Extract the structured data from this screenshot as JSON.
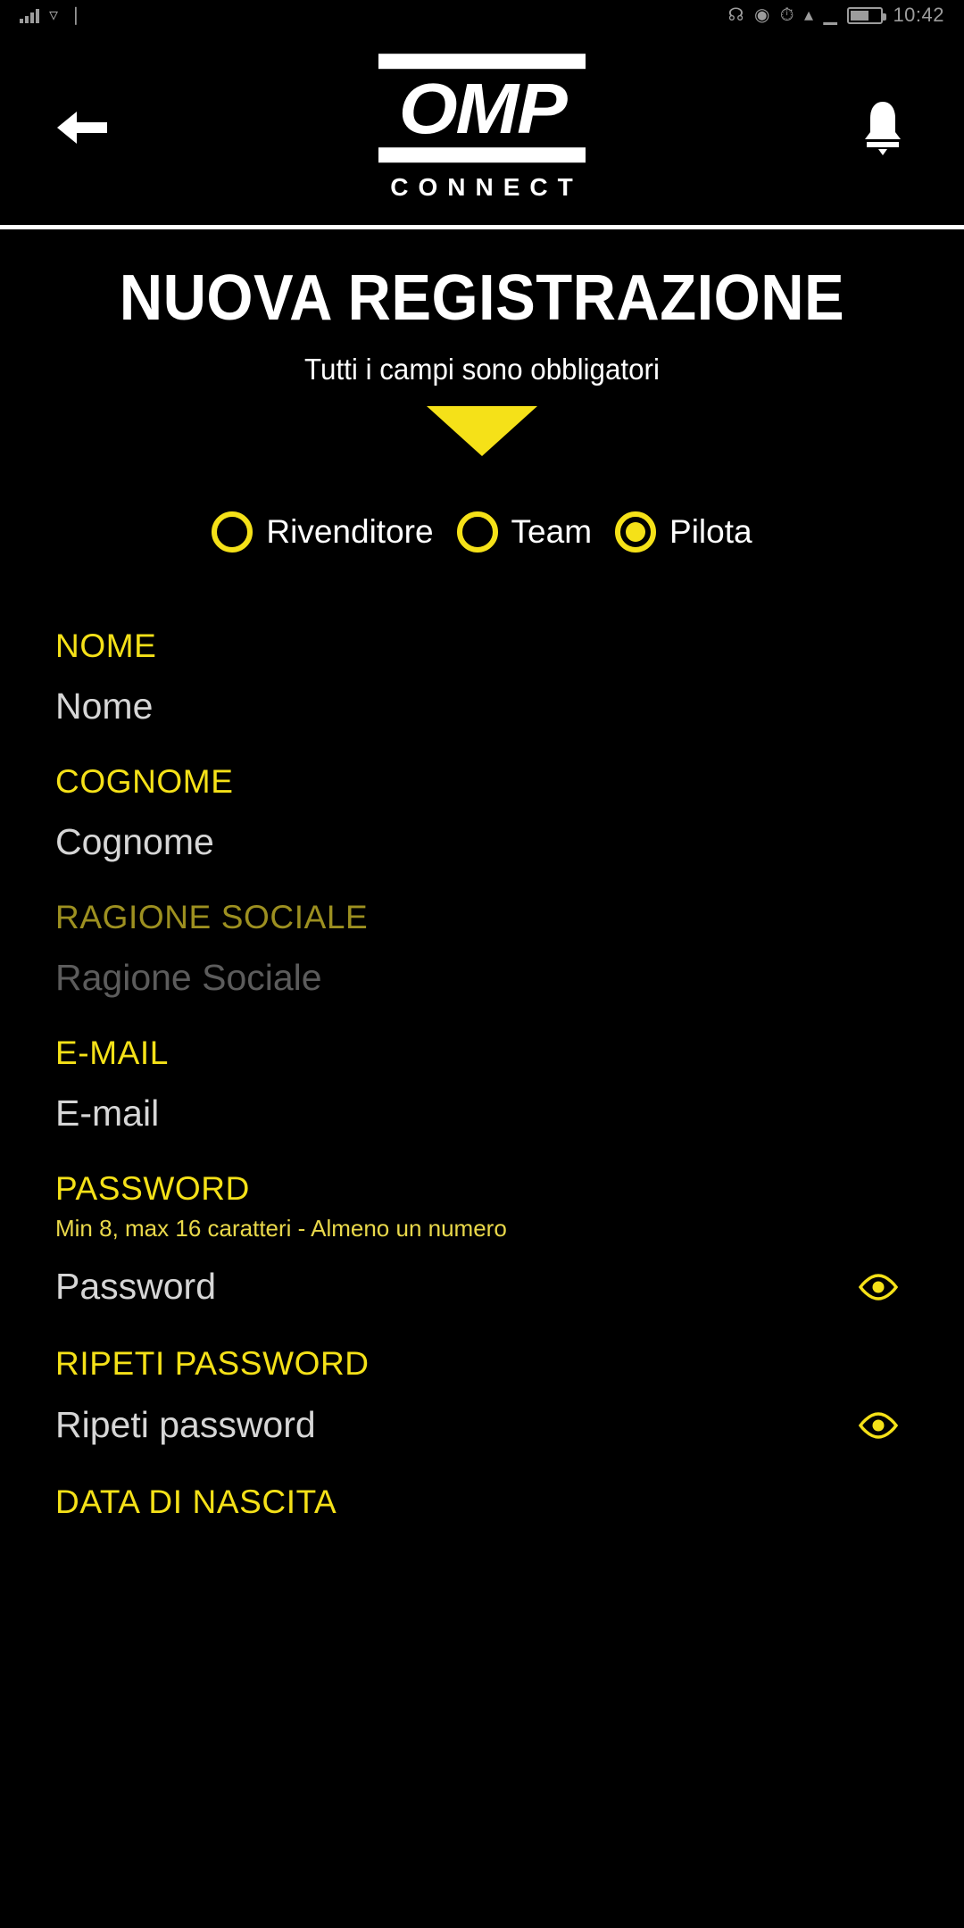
{
  "status_bar": {
    "left_icons": [
      "signal-bars-icon",
      "wifi-icon",
      "vibrate-icon"
    ],
    "right_icons": [
      "bluetooth-icon",
      "location-icon",
      "alarm-icon",
      "wifi-icon",
      "signal-icon",
      "battery-icon"
    ],
    "time": "10:42"
  },
  "app_bar": {
    "back_icon": "arrow-left-icon",
    "notification_icon": "bell-icon",
    "logo_primary": "OMP",
    "logo_secondary": "CONNECT"
  },
  "page": {
    "title": "NUOVA REGISTRAZIONE",
    "subtitle": "Tutti i campi sono obbligatori",
    "caret_icon": "triangle-down-icon"
  },
  "account_type": {
    "options": [
      {
        "label": "Rivenditore",
        "selected": false
      },
      {
        "label": "Team",
        "selected": false
      },
      {
        "label": "Pilota",
        "selected": true
      }
    ]
  },
  "form": {
    "fields": [
      {
        "label": "NOME",
        "placeholder": "Nome",
        "disabled": false,
        "hint": "",
        "eye": false
      },
      {
        "label": "COGNOME",
        "placeholder": "Cognome",
        "disabled": false,
        "hint": "",
        "eye": false
      },
      {
        "label": "RAGIONE SOCIALE",
        "placeholder": "Ragione Sociale",
        "disabled": true,
        "hint": "",
        "eye": false
      },
      {
        "label": "E-MAIL",
        "placeholder": "E-mail",
        "disabled": false,
        "hint": "",
        "eye": false
      },
      {
        "label": "PASSWORD",
        "placeholder": "Password",
        "disabled": false,
        "hint": "Min 8, max 16 caratteri - Almeno un numero",
        "eye": true
      },
      {
        "label": "RIPETI PASSWORD",
        "placeholder": "Ripeti password",
        "disabled": false,
        "hint": "",
        "eye": true
      },
      {
        "label": "DATA DI NASCITA",
        "placeholder": "",
        "disabled": false,
        "hint": "",
        "eye": false
      }
    ],
    "eye_icon": "eye-icon"
  },
  "colors": {
    "background": "#000000",
    "accent_yellow": "#f5e118",
    "accent_yellow_dim": "#9d9020",
    "text_white": "#ffffff",
    "placeholder_grey": "#d6d6d6",
    "placeholder_grey_dim": "#5c5c5c"
  }
}
